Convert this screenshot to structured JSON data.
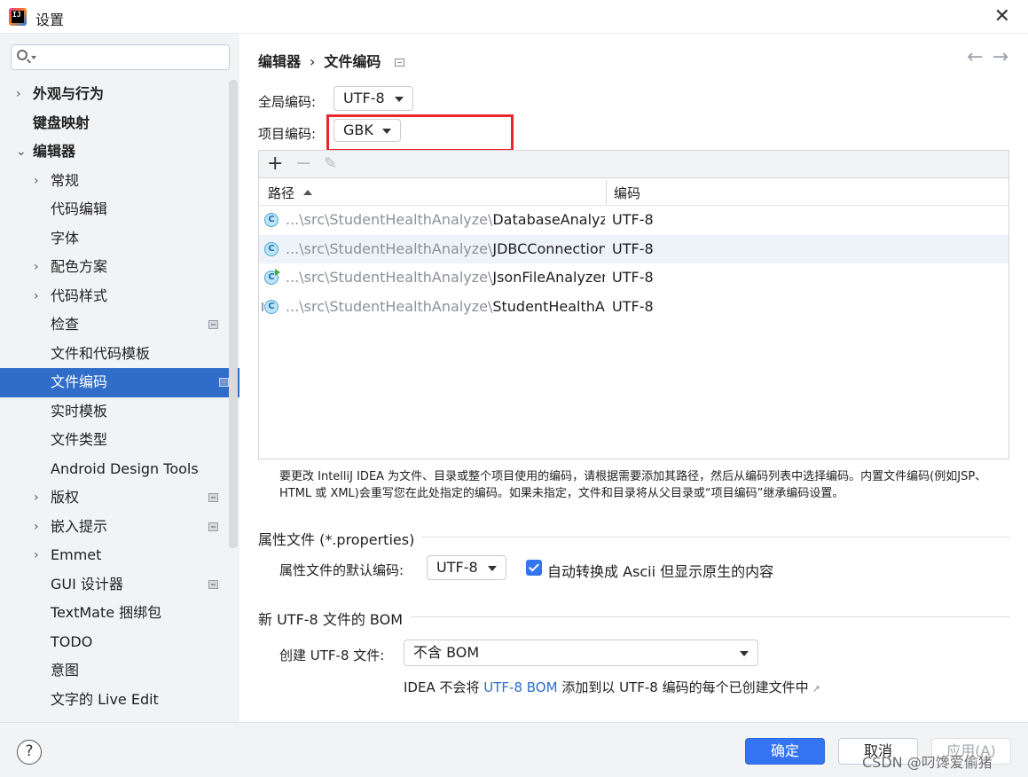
{
  "window": {
    "title": "设置",
    "app_icon_text": "IJ"
  },
  "sidebar": {
    "search": {
      "value": "",
      "placeholder": ""
    },
    "items": [
      {
        "label": "外观与行为",
        "level": 0,
        "chevron": "›"
      },
      {
        "label": "键盘映射",
        "level": 0,
        "chevron": ""
      },
      {
        "label": "编辑器",
        "level": 0,
        "chevron": "⌄"
      },
      {
        "label": "常规",
        "level": 1,
        "chevron": "›"
      },
      {
        "label": "代码编辑",
        "level": 1,
        "chevron": ""
      },
      {
        "label": "字体",
        "level": 1,
        "chevron": ""
      },
      {
        "label": "配色方案",
        "level": 1,
        "chevron": "›"
      },
      {
        "label": "代码样式",
        "level": 1,
        "chevron": "›"
      },
      {
        "label": "检查",
        "level": 1,
        "chevron": ""
      },
      {
        "label": "文件和代码模板",
        "level": 1,
        "chevron": ""
      },
      {
        "label": "文件编码",
        "level": 1,
        "chevron": ""
      },
      {
        "label": "实时模板",
        "level": 1,
        "chevron": ""
      },
      {
        "label": "文件类型",
        "level": 1,
        "chevron": ""
      },
      {
        "label": "Android Design Tools",
        "level": 1,
        "chevron": ""
      },
      {
        "label": "版权",
        "level": 1,
        "chevron": "›"
      },
      {
        "label": "嵌入提示",
        "level": 1,
        "chevron": "›"
      },
      {
        "label": "Emmet",
        "level": 1,
        "chevron": "›"
      },
      {
        "label": "GUI 设计器",
        "level": 1,
        "chevron": ""
      },
      {
        "label": "TextMate 捆绑包",
        "level": 1,
        "chevron": ""
      },
      {
        "label": "TODO",
        "level": 1,
        "chevron": ""
      },
      {
        "label": "意图",
        "level": 1,
        "chevron": ""
      },
      {
        "label": "文字的 Live Edit",
        "level": 1,
        "chevron": ""
      }
    ]
  },
  "breadcrumb": {
    "parent": "编辑器",
    "separator": "›",
    "current": "文件编码"
  },
  "nav": {
    "back": "←",
    "forward": "→"
  },
  "global_encoding": {
    "label": "全局编码:",
    "value": "UTF-8"
  },
  "project_encoding": {
    "label": "项目编码:",
    "value": "GBK"
  },
  "table": {
    "toolbar": {
      "add": "+",
      "remove": "−",
      "edit": "✎"
    },
    "columns": {
      "path": "路径",
      "encoding": "编码"
    },
    "rows": [
      {
        "icon": "C",
        "dir": "...\\src\\StudentHealthAnalyze\\",
        "file": "DatabaseAnalyzer.java",
        "encoding": "UTF-8"
      },
      {
        "icon": "C",
        "dir": "...\\src\\StudentHealthAnalyze\\",
        "file": "JDBCConnection.java",
        "encoding": "UTF-8"
      },
      {
        "icon": "C",
        "dir": "...\\src\\StudentHealthAnalyze\\",
        "file": "JsonFileAnalyzer.java",
        "encoding": "UTF-8"
      },
      {
        "icon": "C",
        "dir": "...\\src\\StudentHealthAnalyze\\",
        "file": "StudentHealthAnalyze.java",
        "encoding": "UTF-8"
      }
    ]
  },
  "help_text": "要更改 IntelliJ IDEA 为文件、目录或整个项目使用的编码，请根据需要添加其路径，然后从编码列表中选择编码。内置文件编码(例如JSP、HTML 或 XML)会重写您在此处指定的编码。如果未指定，文件和目录将从父目录或“项目编码”继承编码设置。",
  "properties": {
    "section_title": "属性文件 (*.properties)",
    "default_label": "属性文件的默认编码:",
    "default_value": "UTF-8",
    "ascii_label": "自动转换成 Ascii 但显示原生的内容",
    "ascii_checked": true
  },
  "bom": {
    "section_title": "新 UTF-8 文件的 BOM",
    "create_label": "创建 UTF-8 文件:",
    "create_value": "不含 BOM",
    "info_prefix": "IDEA 不会将",
    "info_link": "UTF-8 BOM",
    "info_suffix": "添加到以 UTF-8 编码的每个已创建文件中"
  },
  "footer": {
    "help": "?",
    "ok": "确定",
    "cancel": "取消",
    "apply": "应用(A)",
    "watermark": "CSDN @叼馋爱偷猪"
  },
  "colors": {
    "accent": "#3574f0",
    "selection": "#2f6dc9",
    "highlight_border": "#e8262b",
    "link": "#2f6dc9"
  }
}
